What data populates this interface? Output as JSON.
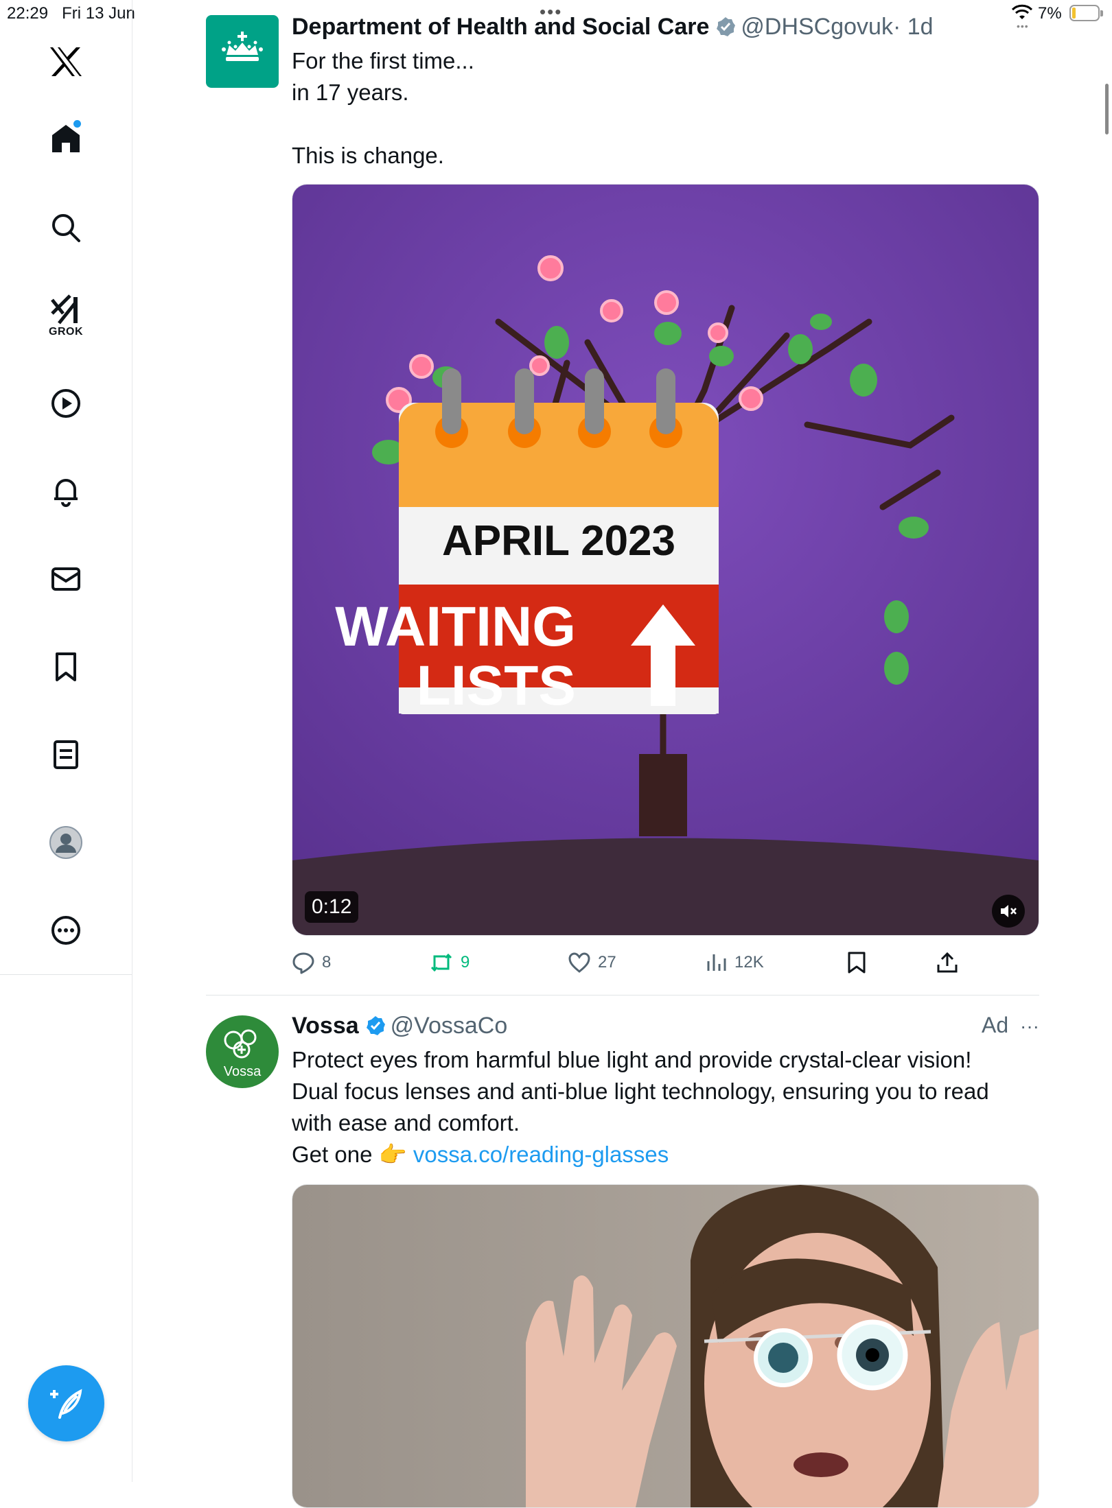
{
  "status_bar": {
    "time": "22:29",
    "date": "Fri 13 Jun",
    "battery": "7%",
    "battery_level": 0.07,
    "top_dots": "•••",
    "sub_dots": "•••"
  },
  "sidebar": {
    "items": [
      {
        "name": "x-logo",
        "icon": "x-logo-icon"
      },
      {
        "name": "home",
        "icon": "home-icon",
        "notification_dot": true
      },
      {
        "name": "explore",
        "icon": "search-icon"
      },
      {
        "name": "grok",
        "icon": "grok-icon",
        "label": "GROK"
      },
      {
        "name": "videos",
        "icon": "play-icon"
      },
      {
        "name": "notifications",
        "icon": "bell-icon"
      },
      {
        "name": "messages",
        "icon": "envelope-icon"
      },
      {
        "name": "bookmarks",
        "icon": "bookmark-icon"
      },
      {
        "name": "lists",
        "icon": "list-icon"
      },
      {
        "name": "profile",
        "icon": "avatar-icon"
      },
      {
        "name": "more",
        "icon": "more-circle-icon"
      }
    ],
    "compose_icon": "compose-icon"
  },
  "tweets": [
    {
      "name": "Department of Health and Social Care",
      "handle": "@DHSCgovuk",
      "time": "· 1d",
      "verified": "grey",
      "text": "For the first time...\nin 17 years.\n\nThis is change.",
      "media": {
        "calendar_title": "APRIL 2023",
        "banner_line1": "WAITING",
        "banner_line2": "LISTS",
        "duration": "0:12",
        "mute_icon": "mute-icon"
      },
      "actions": {
        "replies": "8",
        "reposts": "9",
        "likes": "27",
        "views": "12K"
      }
    },
    {
      "name": "Vossa",
      "handle": "@VossaCo",
      "verified": "blue",
      "ad_label": "Ad",
      "more": "···",
      "avatar_text": "Vossa",
      "text": "Protect eyes from harmful blue light and provide crystal-clear vision!\nDual focus lenses and anti-blue light technology, ensuring you to read\nwith ease and comfort.",
      "cta_prefix": "Get one 👉 ",
      "link": "vossa.co/reading-glasses"
    }
  ],
  "colors": {
    "accent": "#1d9bf0",
    "repost": "#00ba7c",
    "dhsc_green": "#00a287",
    "purple": "#6b3fa0",
    "calendar_orange": "#f8a83a",
    "banner_red": "#d42a14"
  }
}
